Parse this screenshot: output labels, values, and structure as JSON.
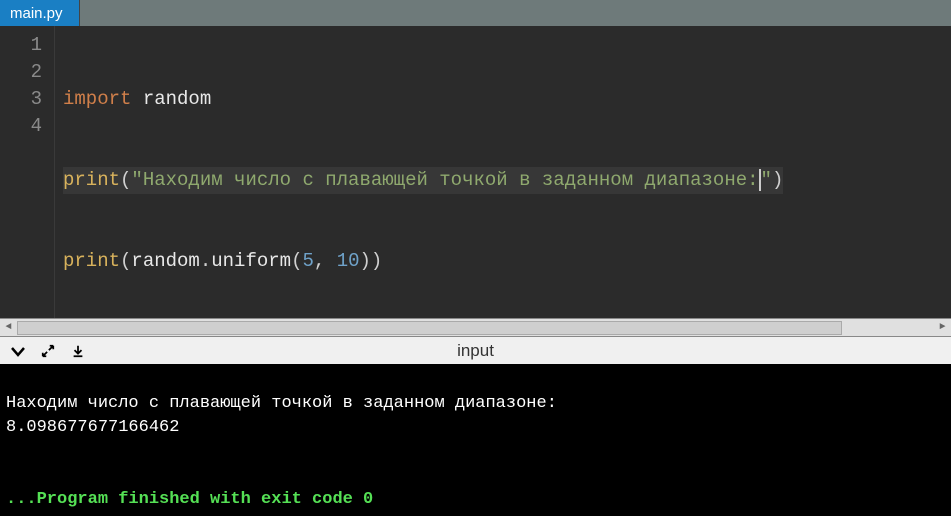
{
  "tab": {
    "filename": "main.py"
  },
  "editor": {
    "line_numbers": [
      "1",
      "2",
      "3",
      "4"
    ],
    "current_line_index": 1,
    "code": {
      "l1": {
        "kw": "import",
        "mod": "random"
      },
      "l2": {
        "fn": "print",
        "str_open": "\"",
        "str_body": "Находим число с плавающей точкой в заданном диапазоне:",
        "str_close": "\""
      },
      "l3": {
        "fn": "print",
        "obj": "random",
        "meth": "uniform",
        "arg1": "5",
        "arg2": "10"
      },
      "l4": ""
    }
  },
  "console_bar": {
    "title": "input",
    "icons": {
      "collapse": "chevron-down-icon",
      "expand": "expand-icon",
      "download": "download-icon"
    }
  },
  "console": {
    "line1": "Находим число с плавающей точкой в заданном диапазоне:",
    "line2": "8.098677677166462",
    "blank1": "",
    "blank2": "",
    "finish": "...Program finished with exit code 0"
  }
}
